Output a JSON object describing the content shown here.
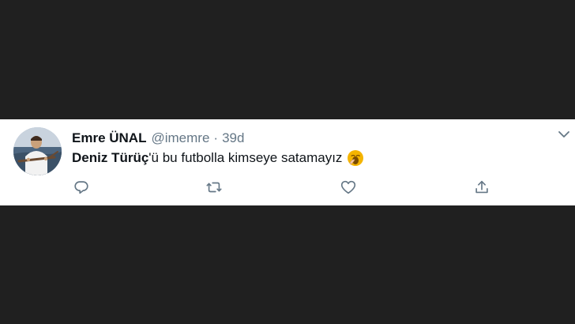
{
  "tweet": {
    "author": {
      "display_name": "Emre ÜNAL",
      "handle": "@imemre"
    },
    "separator": "·",
    "timestamp": "39d",
    "text": {
      "mention": "Deniz Türüç",
      "rest": "'ü bu futbolla kimseye satamayız"
    },
    "emoji": "yawning-face",
    "actions": {
      "reply": "reply-icon",
      "retweet": "retweet-icon",
      "like": "heart-icon",
      "share": "share-icon"
    }
  },
  "colors": {
    "background": "#202020",
    "card": "#ffffff",
    "text": "#0f1419",
    "secondary_text": "#657786",
    "icons": "#657786"
  }
}
